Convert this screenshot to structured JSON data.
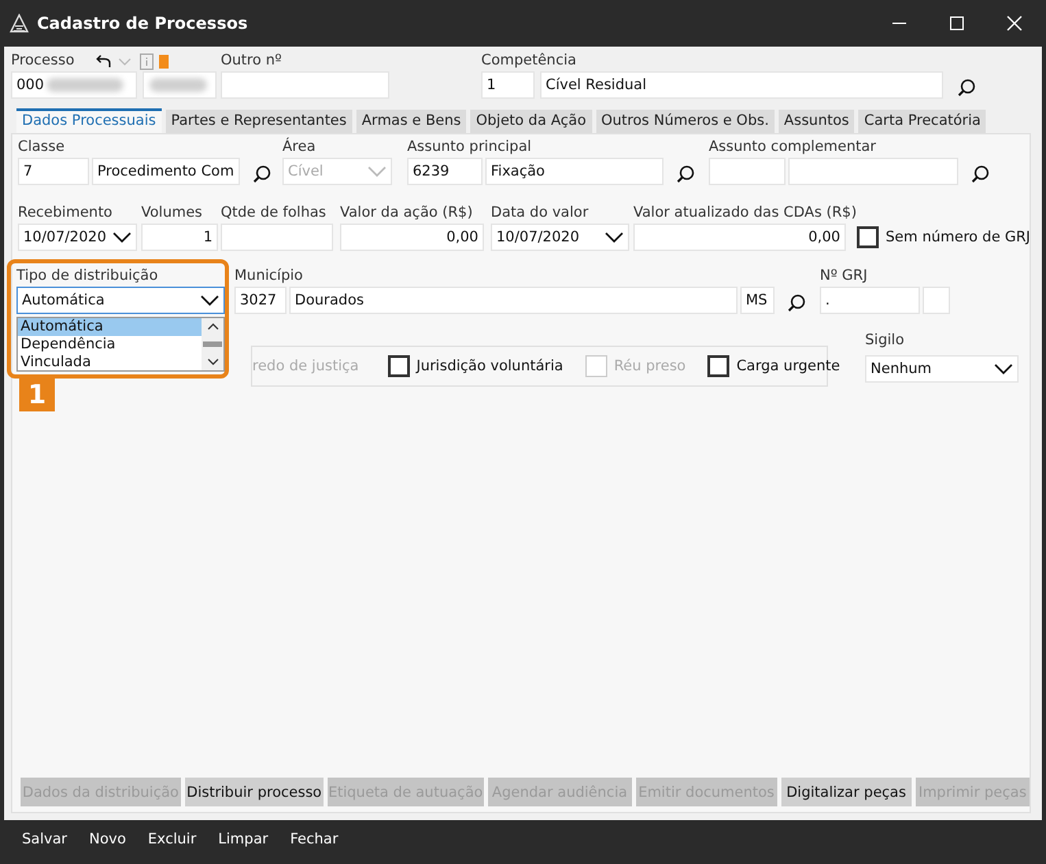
{
  "window": {
    "title": "Cadastro de Processos"
  },
  "header": {
    "processo": {
      "label": "Processo",
      "value": "000"
    },
    "outro": {
      "label": "Outro nº"
    },
    "competencia": {
      "label": "Competência",
      "code": "1",
      "value": "Cível Residual",
      "search": true
    }
  },
  "tabs": [
    {
      "label": "Dados Processuais",
      "selected": true
    },
    {
      "label": "Partes e Representantes",
      "selected": false
    },
    {
      "label": "Armas e Bens",
      "selected": false
    },
    {
      "label": "Objeto da Ação",
      "selected": false
    },
    {
      "label": "Outros Números e Obs.",
      "selected": false
    },
    {
      "label": "Assuntos",
      "selected": false
    },
    {
      "label": "Carta Precatória",
      "selected": false
    }
  ],
  "rows": [
    [
      {
        "kind": "field",
        "label": "Classe",
        "boxes": [
          {
            "value": "7"
          },
          {
            "value": "Procedimento Com"
          }
        ],
        "search": true
      },
      {
        "kind": "combo",
        "label": "Área",
        "value": "Cível",
        "disabled": true
      },
      {
        "kind": "field",
        "label": "Assunto principal",
        "boxes": [
          {
            "value": "6239"
          },
          {
            "value": "Fixação"
          }
        ],
        "search": true
      },
      {
        "kind": "field",
        "label": "Assunto complementar",
        "search": true
      }
    ],
    [
      {
        "kind": "combo",
        "label": "Recebimento",
        "value": "10/07/2020",
        "disabled": false
      },
      {
        "kind": "field",
        "label": "Volumes",
        "boxes": [
          {
            "value": "1"
          }
        ],
        "search": false
      },
      {
        "kind": "field",
        "label": "Qtde de folhas",
        "search": false
      },
      {
        "kind": "field",
        "label": "Valor da ação (R$)",
        "boxes": [
          {
            "value": "0,00"
          }
        ],
        "search": false
      },
      {
        "kind": "combo",
        "label": "Data do valor",
        "value": "10/07/2020",
        "disabled": false
      },
      {
        "kind": "field",
        "label": "Valor atualizado das CDAs (R$)",
        "boxes": [
          {
            "value": "0,00"
          }
        ],
        "search": false
      },
      {
        "kind": "check",
        "label": "Sem número de GRJ",
        "checked": false,
        "disabled": false
      }
    ],
    [
      {
        "kind": "dropdown",
        "label": "Tipo de distribuição",
        "value": "Automática",
        "open": true,
        "options": [
          {
            "label": "Automática",
            "selected": true
          },
          {
            "label": "Dependência",
            "selected": false
          },
          {
            "label": "Vinculada",
            "selected": false
          }
        ],
        "badge": "1"
      },
      {
        "kind": "field",
        "label": "Município",
        "boxes": [
          {
            "value": "3027"
          },
          {
            "value": "Dourados"
          },
          {
            "value": "MS"
          }
        ],
        "search": true
      },
      {
        "kind": "field",
        "label": "Nº GRJ",
        "boxes": [
          {
            "value": "."
          }
        ],
        "search": false
      }
    ]
  ],
  "flags": [
    {
      "kind": "text",
      "label": "redo de justiça",
      "disabled": true
    },
    {
      "kind": "check",
      "label": "Jurisdição voluntária",
      "checked": false,
      "disabled": false
    },
    {
      "kind": "check",
      "label": "Réu preso",
      "checked": false,
      "disabled": true
    },
    {
      "kind": "check",
      "label": "Carga urgente",
      "checked": false,
      "disabled": false
    }
  ],
  "sigilo": {
    "label": "Sigilo",
    "value": "Nenhum"
  },
  "actions": [
    {
      "label": "Dados da distribuição",
      "disabled": true
    },
    {
      "label": "Distribuir processo",
      "disabled": false
    },
    {
      "label": "Etiqueta de autuação",
      "disabled": true
    },
    {
      "label": "Agendar audiência",
      "disabled": true
    },
    {
      "label": "Emitir documentos",
      "disabled": true
    },
    {
      "label": "Digitalizar peças",
      "disabled": false
    },
    {
      "label": "Imprimir peças",
      "disabled": true
    }
  ],
  "footer": [
    "Salvar",
    "Novo",
    "Excluir",
    "Limpar",
    "Fechar"
  ]
}
